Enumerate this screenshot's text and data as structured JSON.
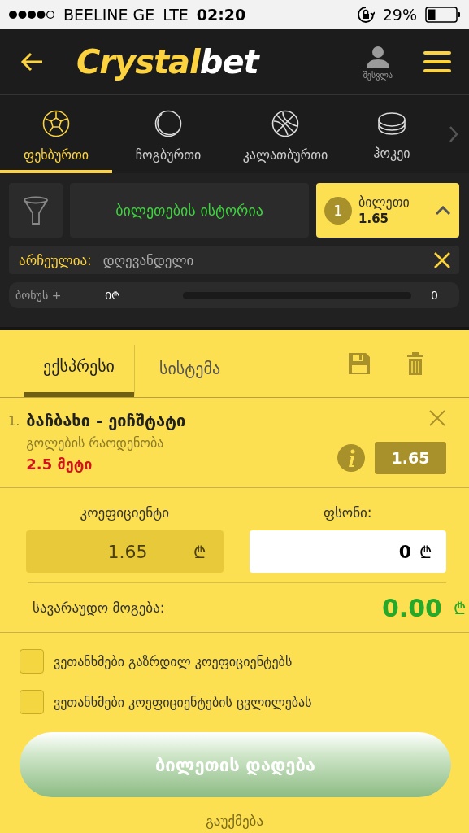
{
  "status_bar": {
    "carrier": "BEELINE GE",
    "network": "LTE",
    "time": "02:20",
    "battery": "29%"
  },
  "header": {
    "logo_part1": "Crystal",
    "logo_part2": "bet",
    "login_label": "შესვლა"
  },
  "sport_tabs": [
    {
      "label": "ფეხბურთი",
      "kind": "football",
      "selected": true
    },
    {
      "label": "ჩოგბურთი",
      "kind": "tennis",
      "selected": false
    },
    {
      "label": "კალათბურთი",
      "kind": "basketball",
      "selected": false
    },
    {
      "label": "ჰოკეი",
      "kind": "hockey",
      "selected": false
    }
  ],
  "toolbar": {
    "history_button": "ბილეთების ისტორია",
    "ticket_count": "1",
    "ticket_label": "ბილეთი",
    "ticket_odds": "1.65",
    "ticket_expanded": true
  },
  "filter": {
    "label": "არჩეულია:",
    "value": "დღევანდელი"
  },
  "bonus": {
    "label": "ბონუს +",
    "amount": "0₾",
    "level": 0,
    "reading": "0"
  },
  "slip_tabs": [
    {
      "label": "ექსპრესი",
      "selected": true
    },
    {
      "label": "სისტემა",
      "selected": false
    }
  ],
  "selections": [
    {
      "number": "1.",
      "match": "ბაჩბახი - ეიჩშტატი",
      "market": "გოლების რაოდენობა",
      "pick": "2.5 მეტი",
      "odds": "1.65"
    }
  ],
  "stake": {
    "odds_label": "კოეფიციენტი",
    "odds_value": "1.65",
    "stake_label": "ფსონი:",
    "stake_value": "0",
    "currency": "₾",
    "win_label": "სავარაუდო მოგება:",
    "win_value": "0.00"
  },
  "agreements": [
    {
      "label": "ვეთანხმები გაზრდილ კოეფიციენტებს",
      "checked": false
    },
    {
      "label": "ვეთანხმები კოეფიციენტების ცვლილებას",
      "checked": false
    }
  ],
  "place_button": "ბილეთის დადება",
  "cancel": "გაუქმება"
}
